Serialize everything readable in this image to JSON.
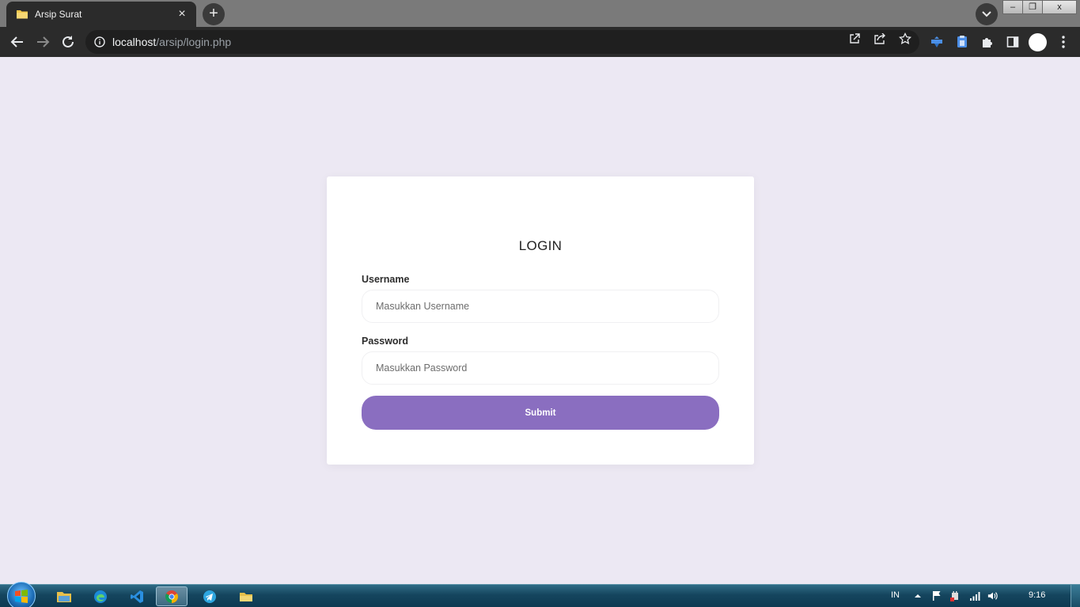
{
  "browser": {
    "tab_title": "Arsip Surat",
    "tab_close": "×",
    "new_tab": "+",
    "url_host": "localhost",
    "url_path": "/arsip/login.php",
    "window_controls": {
      "minimize": "–",
      "restore": "❐",
      "close": "x"
    }
  },
  "page": {
    "heading": "LOGIN",
    "username": {
      "label": "Username",
      "placeholder": "Masukkan Username",
      "value": ""
    },
    "password": {
      "label": "Password",
      "placeholder": "Masukkan Password",
      "value": ""
    },
    "submit_label": "Submit",
    "accent_color": "#8a6ec0",
    "background_color": "#ece8f3"
  },
  "taskbar": {
    "pinned": [
      "file-explorer-icon",
      "edge-icon",
      "vscode-icon",
      "chrome-icon",
      "telegram-icon",
      "folder-icon"
    ],
    "language": "IN",
    "clock": "9:16"
  }
}
